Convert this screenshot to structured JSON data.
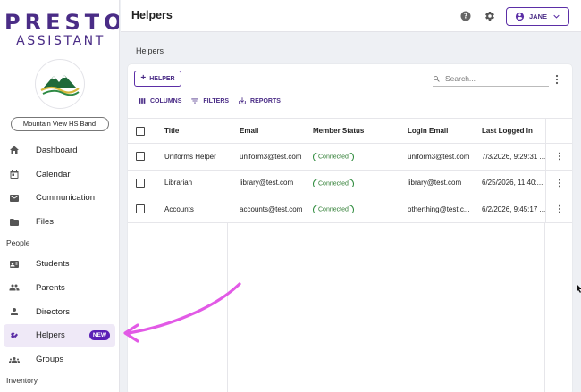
{
  "brand": {
    "line1": "PRESTO",
    "line2": "ASSISTANT"
  },
  "org": {
    "name": "Mountain View HS Band"
  },
  "nav": {
    "items_main": [
      {
        "label": "Dashboard",
        "icon": "home-icon"
      },
      {
        "label": "Calendar",
        "icon": "calendar-icon"
      },
      {
        "label": "Communication",
        "icon": "mail-icon"
      },
      {
        "label": "Files",
        "icon": "folder-icon"
      }
    ],
    "section_people": "People",
    "items_people": [
      {
        "label": "Students",
        "icon": "id-card-icon"
      },
      {
        "label": "Parents",
        "icon": "people-icon"
      },
      {
        "label": "Directors",
        "icon": "person-icon"
      },
      {
        "label": "Helpers",
        "icon": "helpers-icon",
        "badge": "NEW",
        "active": true
      },
      {
        "label": "Groups",
        "icon": "groups-icon"
      }
    ],
    "section_inventory": "Inventory"
  },
  "header": {
    "title": "Helpers",
    "user": "JANE"
  },
  "breadcrumb": "Helpers",
  "toolbar": {
    "add_label": "HELPER",
    "columns_label": "COLUMNS",
    "filters_label": "FILTERS",
    "reports_label": "REPORTS",
    "search_placeholder": "Search..."
  },
  "table": {
    "headers": [
      "Title",
      "Email",
      "Member Status",
      "Login Email",
      "Last Logged In"
    ],
    "rows": [
      {
        "title": "Uniforms Helper",
        "email": "uniform3@test.com",
        "status": "Connected",
        "login": "uniform3@test.com",
        "last": "7/3/2026, 9:29:31 ..."
      },
      {
        "title": "Librarian",
        "email": "library@test.com",
        "status": "Connected",
        "login": "library@test.com",
        "last": "6/25/2026, 11:40:..."
      },
      {
        "title": "Accounts",
        "email": "accounts@test.com",
        "status": "Connected",
        "login": "otherthing@test.c...",
        "last": "6/2/2026, 9:45:17 ..."
      }
    ]
  },
  "colors": {
    "brand": "#4a2c86",
    "accent": "#5b2ea6",
    "status": "#2e7d32",
    "arrow": "#e25ae6"
  }
}
